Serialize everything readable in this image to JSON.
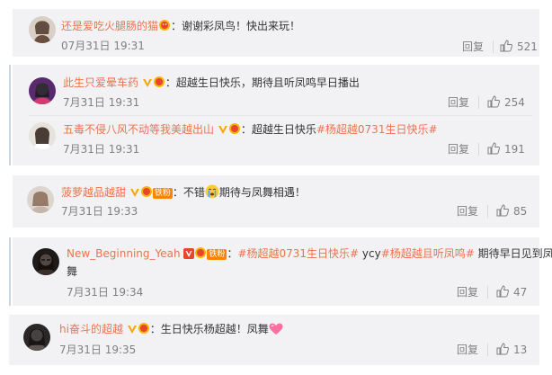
{
  "comments": [
    {
      "user": "还是爱吃火腿肠的猫",
      "text": "：谢谢彩凤鸟！快出来玩！",
      "time": "07月31日 19:31",
      "reply": "回复",
      "likes": "521"
    },
    {
      "user": "此生只爱晕车药",
      "text": "：超越生日快乐，期待且听凤鸣早日播出",
      "time": "7月31日 19:31",
      "reply": "回复",
      "likes": "254"
    },
    {
      "user": "五毒不侵八风不动等我美越出山",
      "text": "：超越生日快乐",
      "topic": "#杨超越0731生日快乐#",
      "time": "7月31日 19:31",
      "reply": "回复",
      "likes": "191"
    },
    {
      "user": "菠萝越品越甜",
      "fan_badge": "铁粉",
      "text_before": "：不错",
      "text_after": "期待与凤舞相遇！",
      "time": "7月31日 19:33",
      "reply": "回复",
      "likes": "85"
    },
    {
      "user": "New_Beginning_Yeah",
      "fan_badge": "铁粉",
      "topic1": "#杨超越0731生日快乐#",
      "mid": " ycy",
      "topic2": "#杨超越且听凤鸣#",
      "text_line1_end": " 期待早日见到凤",
      "text_line2": "舞",
      "time": "7月31日 19:34",
      "reply": "回复",
      "likes": "47"
    },
    {
      "user": "hi奋斗的超越",
      "text": "：生日快乐杨超越！凤舞",
      "time": "7月31日 19:35",
      "reply": "回复",
      "likes": "13"
    }
  ],
  "colors": {
    "username": "#eb7350",
    "topic": "#eb7350",
    "meta": "#808080",
    "card_bg": "#f2f2f5"
  }
}
